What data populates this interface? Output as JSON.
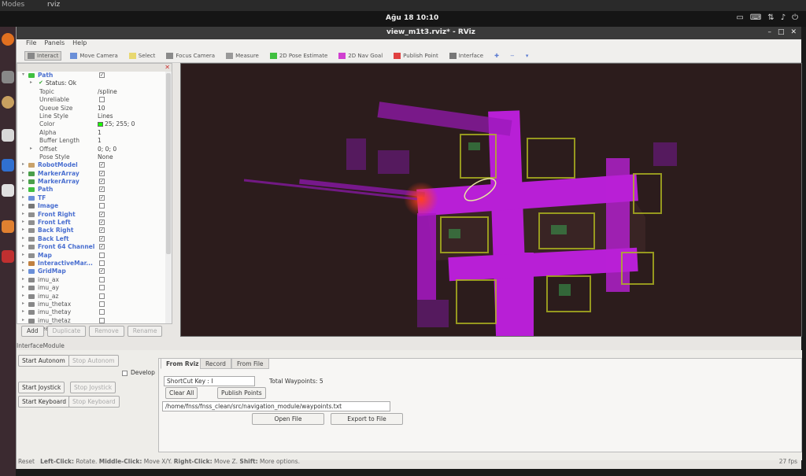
{
  "monitor": {
    "left_label": "Modes",
    "window_menu": "rviz"
  },
  "topbar": {
    "clock": "Ağu 18 10:10"
  },
  "window": {
    "title": "view_m1t3.rviz* - RViz",
    "menu": [
      "File",
      "Panels",
      "Help"
    ]
  },
  "toolbar": [
    {
      "label": "Interact",
      "icon": "interact-icon",
      "color": "#888888"
    },
    {
      "label": "Move Camera",
      "icon": "move-camera-icon",
      "color": "#6a8fd8"
    },
    {
      "label": "Select",
      "icon": "select-icon",
      "color": "#e8d870"
    },
    {
      "label": "Focus Camera",
      "icon": "focus-camera-icon",
      "color": "#8a8a8a"
    },
    {
      "label": "Measure",
      "icon": "measure-icon",
      "color": "#999999"
    },
    {
      "label": "2D Pose Estimate",
      "icon": "pose-estimate-icon",
      "color": "#40c040"
    },
    {
      "label": "2D Nav Goal",
      "icon": "nav-goal-icon",
      "color": "#d040d0"
    },
    {
      "label": "Publish Point",
      "icon": "publish-point-icon",
      "color": "#e04040"
    },
    {
      "label": "Interface",
      "icon": "interface-icon",
      "color": "#777777"
    }
  ],
  "displays": {
    "path_item": {
      "label": "Path",
      "status": "Status: Ok"
    },
    "properties": [
      {
        "name": "Topic",
        "value": "/spline"
      },
      {
        "name": "Unreliable",
        "value": ""
      },
      {
        "name": "Queue Size",
        "value": "10"
      },
      {
        "name": "Line Style",
        "value": "Lines"
      },
      {
        "name": "Color",
        "value": "25; 255; 0"
      },
      {
        "name": "Alpha",
        "value": "1"
      },
      {
        "name": "Buffer Length",
        "value": "1"
      },
      {
        "name": "Offset",
        "value": "0; 0; 0"
      },
      {
        "name": "Pose Style",
        "value": "None"
      }
    ],
    "items": [
      {
        "label": "RobotModel",
        "checked": true,
        "icon_color": "#c9a26a"
      },
      {
        "label": "MarkerArray",
        "checked": true,
        "icon_color": "#4a9f4a"
      },
      {
        "label": "MarkerArray",
        "checked": true,
        "icon_color": "#4a9f4a"
      },
      {
        "label": "Path",
        "checked": true,
        "icon_color": "#40c040"
      },
      {
        "label": "TF",
        "checked": true,
        "icon_color": "#6a8fd8"
      },
      {
        "label": "Image",
        "checked": false,
        "icon_color": "#777777"
      },
      {
        "label": "Front Right",
        "checked": true,
        "icon_color": "#8f8f8f"
      },
      {
        "label": "Front Left",
        "checked": true,
        "icon_color": "#8f8f8f"
      },
      {
        "label": "Back Right",
        "checked": true,
        "icon_color": "#8f8f8f"
      },
      {
        "label": "Back Left",
        "checked": true,
        "icon_color": "#8f8f8f"
      },
      {
        "label": "Front 64 Channel",
        "checked": true,
        "icon_color": "#8f8f8f"
      },
      {
        "label": "Map",
        "checked": false,
        "icon_color": "#8f8f8f"
      },
      {
        "label": "InteractiveMar...",
        "checked": false,
        "icon_color": "#c08040"
      },
      {
        "label": "GridMap",
        "checked": true,
        "icon_color": "#6a8fd8"
      },
      {
        "label": "imu_ax",
        "checked": false,
        "icon_color": "#888888"
      },
      {
        "label": "imu_ay",
        "checked": false,
        "icon_color": "#888888"
      },
      {
        "label": "imu_az",
        "checked": false,
        "icon_color": "#888888"
      },
      {
        "label": "imu_thetax",
        "checked": false,
        "icon_color": "#888888"
      },
      {
        "label": "imu_thetay",
        "checked": false,
        "icon_color": "#888888"
      },
      {
        "label": "imu_thetaz",
        "checked": false,
        "icon_color": "#888888"
      },
      {
        "label": "heading_error",
        "checked": false,
        "icon_color": "#888888"
      }
    ],
    "buttons": {
      "add": "Add",
      "duplicate": "Duplicate",
      "remove": "Remove",
      "rename": "Rename"
    }
  },
  "interface_module": {
    "title": "InterfaceModule",
    "start_autonom": "Start Autonom",
    "stop_autonom": "Stop Autonom",
    "develop": "Develop",
    "start_joystick": "Start Joystick",
    "stop_joystick": "Stop Joystick",
    "start_keyboard": "Start Keyboard",
    "stop_keyboard": "Stop Keyboard",
    "tabs": [
      "From Rviz",
      "Record",
      "From File"
    ],
    "shortcut_label": "ShortCut Key : I",
    "total_waypoints": "Total Waypoints:  5",
    "clear_all": "Clear All",
    "publish_points": "Publish Points",
    "file_path": "/home/fnss/fnss_clean/src/navigation_module/waypoints.txt",
    "open_file": "Open File",
    "export_to_file": "Export to File"
  },
  "statusbar": {
    "reset": "Reset",
    "hint_1": "Left-Click:",
    "hint_1b": "Rotate.",
    "hint_2": "Middle-Click:",
    "hint_2b": "Move X/Y.",
    "hint_3": "Right-Click:",
    "hint_3b": "Move Z.",
    "hint_4": "Shift:",
    "hint_4b": "More options.",
    "fps": "27 fps"
  },
  "colors": {
    "map_magenta": "#c020e0",
    "map_bg": "#2c1c1c",
    "robot_red": "#ff3020",
    "path_green": "#19ff00"
  }
}
